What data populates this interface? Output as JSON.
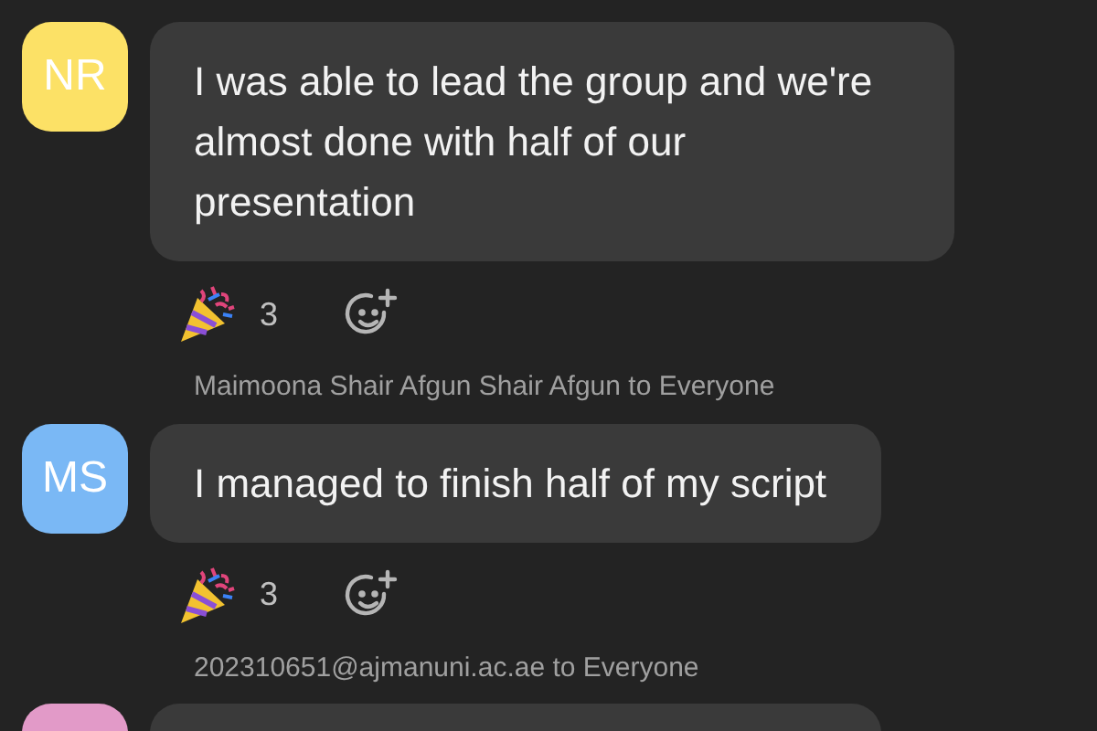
{
  "messages": [
    {
      "initials": "NR",
      "color": "#fce166",
      "text": "I was able to lead the group and we're almost done with half of our presentation",
      "reaction_count": "3"
    },
    {
      "sender": "Maimoona Shair Afgun Shair Afgun to Everyone",
      "initials": "MS",
      "color": "#7ab8f5",
      "text": "I managed to finish half of my script",
      "reaction_count": "3"
    },
    {
      "sender": "202310651@ajmanuni.ac.ae to Everyone",
      "color": "#e29ac8"
    }
  ]
}
